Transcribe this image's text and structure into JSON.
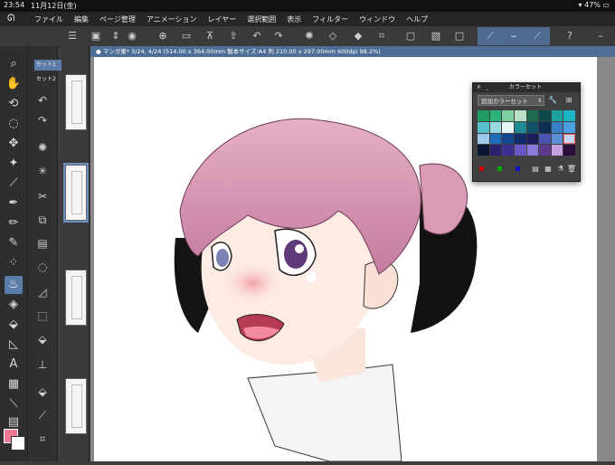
{
  "status_bar": {
    "time": "23:54",
    "date": "11月12日(金)",
    "battery": "47%"
  },
  "menu": {
    "items": [
      "ファイル",
      "編集",
      "ページ管理",
      "アニメーション",
      "レイヤー",
      "選択範囲",
      "表示",
      "フィルター",
      "ウィンドウ",
      "ヘルプ"
    ]
  },
  "pages_panel": {
    "tabs": [
      "セット1",
      "セット2"
    ]
  },
  "canvas": {
    "tab_title": "● マンガ東* 3/24, 4/24 (514.00 x 364.00mm 製本サイズ:A4 判 210.00 x 297.00mm 600dpi 98.2%)"
  },
  "color_set_panel": {
    "title": "カラーセット",
    "selected_set": "追加カラーセット",
    "swatches": [
      "#1f9d62",
      "#2bb37a",
      "#7ed0a3",
      "#b9e0c6",
      "#1e6b50",
      "#0f4a4a",
      "#1aa3a0",
      "#1bb5c8",
      "#56c2c9",
      "#9ad9de",
      "#e5f5f5",
      "#1e8a95",
      "#12506a",
      "#0b2f55",
      "#3b7fc4",
      "#4a9fe0",
      "#9ec9ea",
      "#1c6fb8",
      "#14488f",
      "#0d2b68",
      "#1a1d5a",
      "#4b54b0",
      "#5f8fd8",
      "#c5d6ef",
      "#0a1433",
      "#2d2270",
      "#3c2f93",
      "#6b57c4",
      "#8a7ad9",
      "#5e3a8a",
      "#c7a1dd",
      "#2a0f3d"
    ]
  },
  "colors": {
    "accent": "#5b7da8",
    "main_color": "#f07890",
    "sub_color": "#ffffff"
  }
}
